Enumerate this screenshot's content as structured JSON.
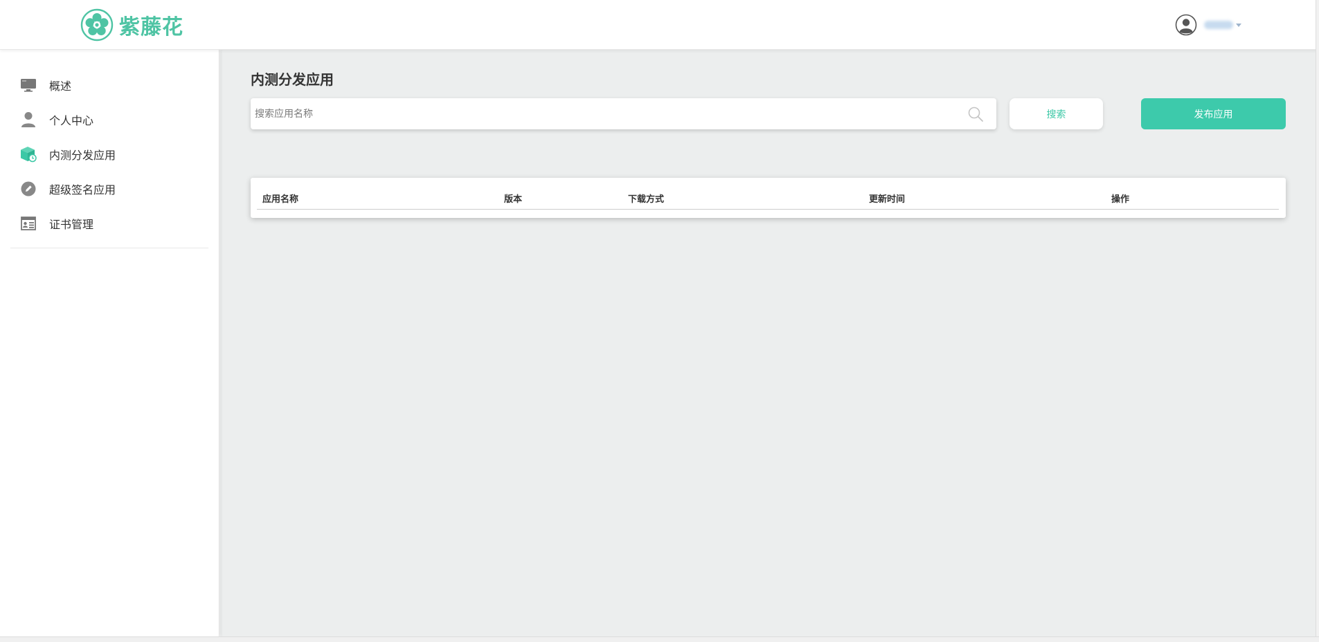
{
  "header": {
    "brand": "紫藤花",
    "brand_color": "#4fc4a4"
  },
  "sidebar": {
    "items": [
      {
        "label": "概述",
        "icon": "monitor-icon"
      },
      {
        "label": "个人中心",
        "icon": "user-icon"
      },
      {
        "label": "内测分发应用",
        "icon": "package-icon",
        "active": true
      },
      {
        "label": "超级签名应用",
        "icon": "pen-icon"
      },
      {
        "label": "证书管理",
        "icon": "certificate-icon"
      }
    ]
  },
  "main": {
    "title": "内测分发应用",
    "search": {
      "placeholder": "搜索应用名称",
      "value": "",
      "button_label": "搜索"
    },
    "publish_label": "发布应用",
    "table": {
      "columns": [
        "应用名称",
        "版本",
        "下载方式",
        "更新时间",
        "操作"
      ],
      "rows": []
    }
  },
  "colors": {
    "accent": "#3dcaab",
    "content_bg": "#eceeee"
  }
}
